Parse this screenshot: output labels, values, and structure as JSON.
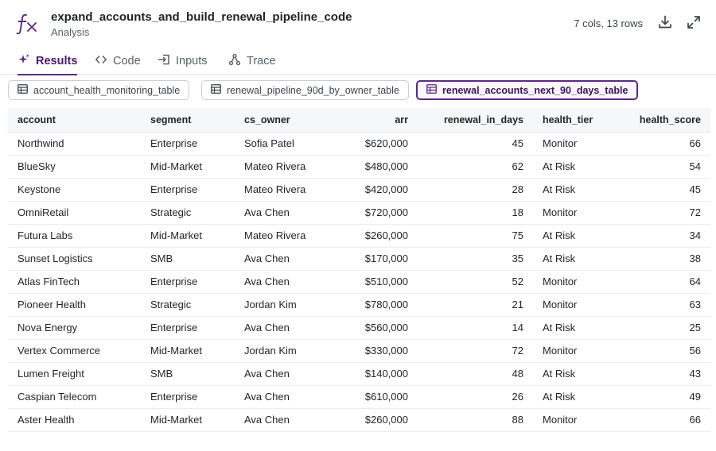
{
  "header": {
    "title": "expand_accounts_and_build_renewal_pipeline_code",
    "subtitle": "Analysis",
    "meta": "7 cols, 13 rows",
    "icons": [
      "function-icon",
      "download-icon",
      "expand-icon"
    ]
  },
  "tabs": [
    {
      "label": "Results",
      "icon": "sparkle-icon",
      "active": true
    },
    {
      "label": "Code",
      "icon": "code-icon",
      "active": false
    },
    {
      "label": "Inputs",
      "icon": "input-icon",
      "active": false
    },
    {
      "label": "Trace",
      "icon": "trace-icon",
      "active": false
    }
  ],
  "chips": [
    {
      "label": "account_health_monitoring_table",
      "icon": "table-icon",
      "active": false
    },
    {
      "label": "renewal_pipeline_90d_by_owner_table",
      "icon": "table-icon",
      "active": false
    },
    {
      "label": "renewal_accounts_next_90_days_table",
      "icon": "table-icon",
      "active": true
    }
  ],
  "colors": {
    "accent": "#5b2a86",
    "accent_text": "#4a1a6e"
  },
  "table": {
    "columns": [
      "account",
      "segment",
      "cs_owner",
      "arr",
      "renewal_in_days",
      "health_tier",
      "health_score"
    ],
    "rows": [
      [
        "Northwind",
        "Enterprise",
        "Sofia Patel",
        "$620,000",
        "45",
        "Monitor",
        "66"
      ],
      [
        "BlueSky",
        "Mid-Market",
        "Mateo Rivera",
        "$480,000",
        "62",
        "At Risk",
        "54"
      ],
      [
        "Keystone",
        "Enterprise",
        "Mateo Rivera",
        "$420,000",
        "28",
        "At Risk",
        "45"
      ],
      [
        "OmniRetail",
        "Strategic",
        "Ava Chen",
        "$720,000",
        "18",
        "Monitor",
        "72"
      ],
      [
        "Futura Labs",
        "Mid-Market",
        "Mateo Rivera",
        "$260,000",
        "75",
        "At Risk",
        "34"
      ],
      [
        "Sunset Logistics",
        "SMB",
        "Ava Chen",
        "$170,000",
        "35",
        "At Risk",
        "38"
      ],
      [
        "Atlas FinTech",
        "Enterprise",
        "Ava Chen",
        "$510,000",
        "52",
        "Monitor",
        "64"
      ],
      [
        "Pioneer Health",
        "Strategic",
        "Jordan Kim",
        "$780,000",
        "21",
        "Monitor",
        "63"
      ],
      [
        "Nova Energy",
        "Enterprise",
        "Ava Chen",
        "$560,000",
        "14",
        "At Risk",
        "25"
      ],
      [
        "Vertex Commerce",
        "Mid-Market",
        "Jordan Kim",
        "$330,000",
        "72",
        "Monitor",
        "56"
      ],
      [
        "Lumen Freight",
        "SMB",
        "Ava Chen",
        "$140,000",
        "48",
        "At Risk",
        "43"
      ],
      [
        "Caspian Telecom",
        "Enterprise",
        "Ava Chen",
        "$610,000",
        "26",
        "At Risk",
        "49"
      ],
      [
        "Aster Health",
        "Mid-Market",
        "Ava Chen",
        "$260,000",
        "88",
        "Monitor",
        "66"
      ]
    ]
  }
}
